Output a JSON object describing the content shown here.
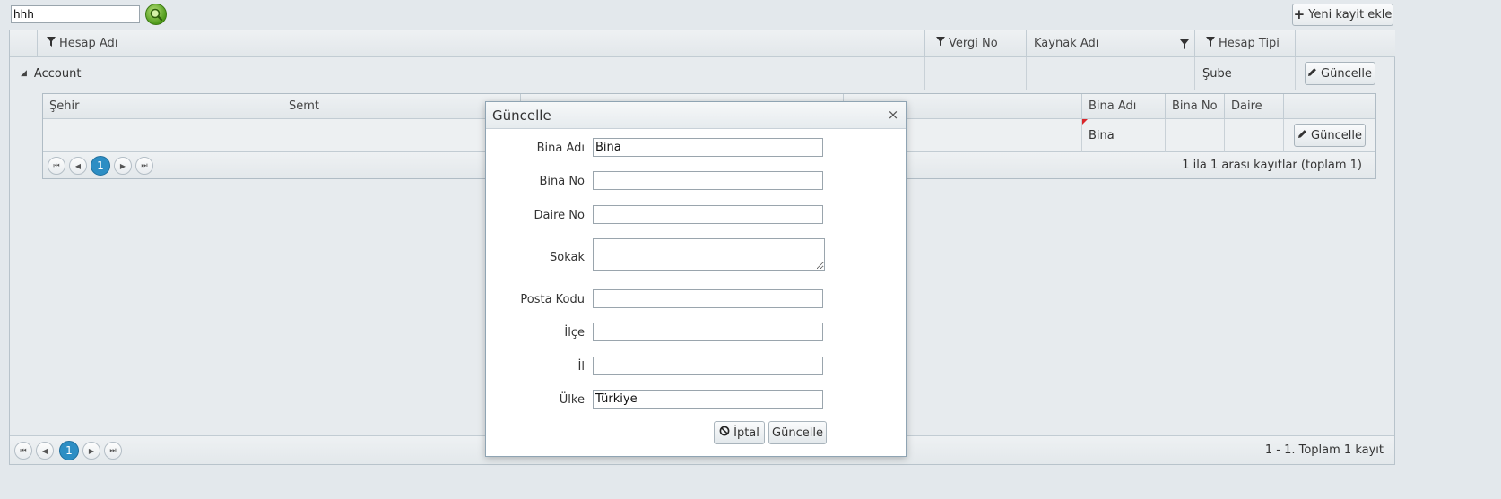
{
  "toolbar": {
    "search_value": "hhh",
    "search_icon": "magnifier-icon",
    "add_label": "Yeni kayit ekle",
    "add_icon": "plus-icon"
  },
  "grid": {
    "columns": [
      "Hesap Adı",
      "Vergi No",
      "Kaynak Adı",
      "Hesap Tipi"
    ],
    "row": {
      "expand_icon": "triangle-down-icon",
      "hesap_adi": "Account",
      "vergi_no": "",
      "kaynak_adi": "",
      "hesap_tipi": "Şube",
      "edit_label": "Güncelle"
    },
    "pager": {
      "current_page": "1",
      "info": "1 - 1. Toplam 1 kayıt"
    }
  },
  "subgrid": {
    "columns": [
      "Şehir",
      "Semt",
      "",
      "",
      "",
      "Bina Adı",
      "Bina No",
      "Daire"
    ],
    "row": {
      "bina_adi": "Bina",
      "edit_label": "Güncelle"
    },
    "pager": {
      "current_page": "1",
      "info": "1 ila 1 arası kayıtlar (toplam 1)"
    }
  },
  "dialog": {
    "title": "Güncelle",
    "close_glyph": "×",
    "fields": [
      {
        "label": "Bina Adı",
        "value": "Bina"
      },
      {
        "label": "Bina No",
        "value": ""
      },
      {
        "label": "Daire No",
        "value": ""
      },
      {
        "label": "Sokak",
        "value": ""
      },
      {
        "label": "Posta Kodu",
        "value": ""
      },
      {
        "label": "İlçe",
        "value": ""
      },
      {
        "label": "İl",
        "value": ""
      },
      {
        "label": "Ülke",
        "value": "Türkiye"
      }
    ],
    "cancel_label": "İptal",
    "cancel_icon": "cancel-icon",
    "submit_label": "Güncelle"
  },
  "colors": {
    "accent": "#2d8ec4",
    "search_green": "#4e9a1a",
    "dirty_marker": "#d9262a"
  }
}
